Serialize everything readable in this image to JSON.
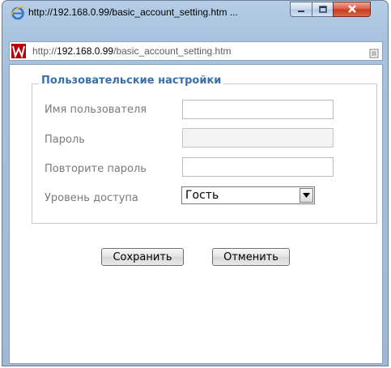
{
  "window": {
    "title": "http://192.168.0.99/basic_account_setting.htm ..."
  },
  "address_bar": {
    "prefix": "http://",
    "host": "192.168.0.99",
    "path": "/basic_account_setting.htm"
  },
  "form": {
    "legend": "Пользовательские настройки",
    "username_label": "Имя пользователя",
    "username_value": "",
    "password_label": "Пароль",
    "password_value": "",
    "confirm_label": "Повторите пароль",
    "confirm_value": "",
    "access_label": "Уровень доступа",
    "access_value": "Гость"
  },
  "buttons": {
    "save": "Сохранить",
    "cancel": "Отменить"
  },
  "colors": {
    "legend": "#3b6fa8",
    "label": "#7a7a7a",
    "close_button": "#c7381d"
  },
  "icons": {
    "window": "internet-explorer-icon",
    "site": "site-logo-icon",
    "compat": "compatibility-view-icon"
  }
}
